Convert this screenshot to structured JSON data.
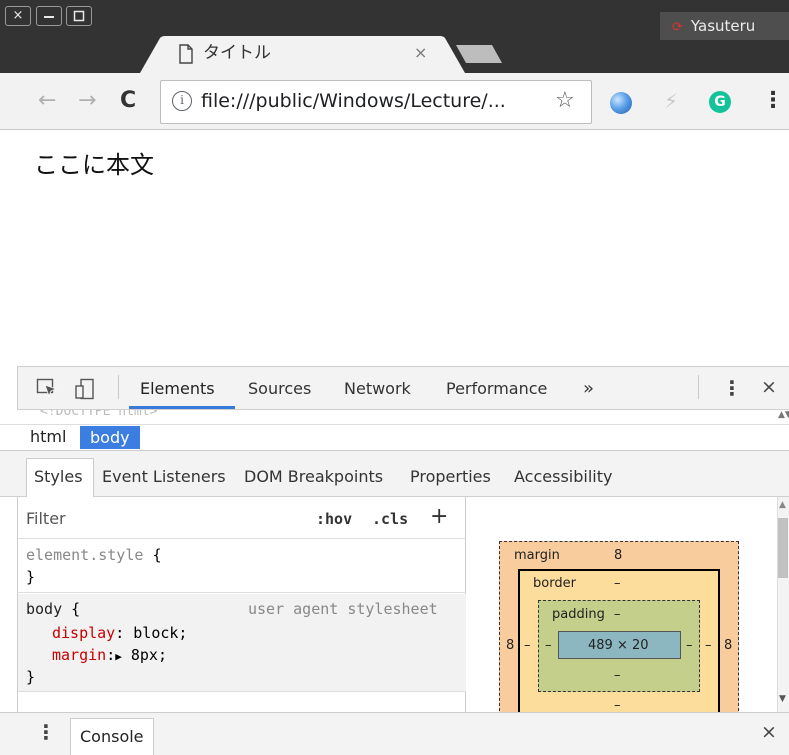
{
  "window": {
    "close_glyph": "×",
    "profile_name": "Yasuteru"
  },
  "tab": {
    "title": "タイトル",
    "close_glyph": "×"
  },
  "toolbar": {
    "back_glyph": "←",
    "forward_glyph": "→",
    "reload_glyph": "C",
    "info_glyph": "i",
    "url": "file:///public/Windows/Lecture/...",
    "star_glyph": "☆",
    "grammarly_letter": "G",
    "menu_glyph": "⋮"
  },
  "page": {
    "body_text": "ここに本文"
  },
  "devtools": {
    "tabs": [
      "Elements",
      "Sources",
      "Network",
      "Performance"
    ],
    "more_tabs_glyph": "»",
    "more_glyph": "⋮",
    "close_glyph": "×",
    "dom_peek": "<!DOCTYPE html>",
    "breadcrumbs": [
      "html",
      "body"
    ],
    "subtabs": [
      "Styles",
      "Event Listeners",
      "DOM Breakpoints",
      "Properties",
      "Accessibility"
    ],
    "filter_placeholder": "Filter",
    "hov_label": ":hov",
    "cls_label": ".cls",
    "add_rule_glyph": "+",
    "rules": {
      "element_style_selector": "element.style",
      "open_brace": "{",
      "close_brace": "}",
      "body_selector": "body",
      "body_source": "user agent stylesheet",
      "decl1_prop": "display",
      "decl1_value": "block;",
      "decl2_prop": "margin",
      "decl2_value": "8px;",
      "expand_glyph": "▶"
    },
    "box_model": {
      "margin_label": "margin",
      "margin_value": "8",
      "margin_left": "8",
      "margin_right": "8",
      "border_label": "border",
      "border_value": "–",
      "padding_label": "padding",
      "padding_value": "–",
      "content_size": "489 × 20",
      "dash": "–"
    },
    "drawer": {
      "menu_glyph": "⋮",
      "console_label": "Console",
      "close_glyph": "×"
    }
  }
}
